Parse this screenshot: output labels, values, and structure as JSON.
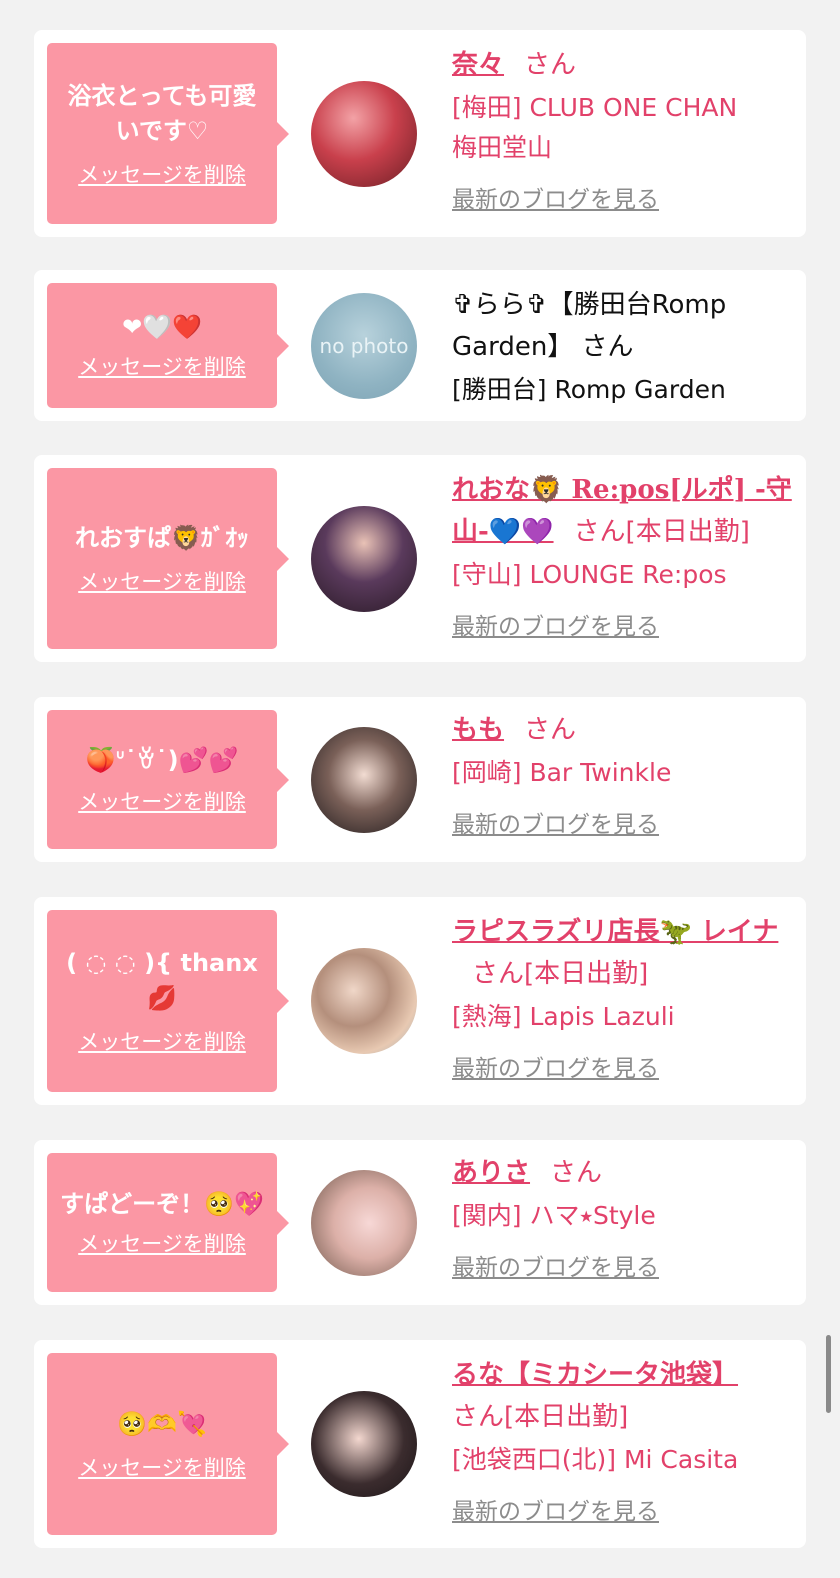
{
  "cards": [
    {
      "message": "浴衣とっても可愛いです♡",
      "delete_label": "メッセージを削除",
      "name": "奈々",
      "san": "さん",
      "shop_line1": "[梅田] CLUB ONE CHAN",
      "shop_line2": "梅田堂山",
      "blog_label": "最新のブログを見る"
    },
    {
      "message": "❤🤍❤️",
      "delete_label": "メッセージを削除",
      "name": "✞らら✞【勝田台Romp Garden】 さん",
      "shop_line1": "[勝田台] Romp Garden",
      "avatar_text": "no photo"
    },
    {
      "message": "れおすぱ🦁ｶﾞｵｯ",
      "delete_label": "メッセージを削除",
      "name": "れおな🦁 Re:pos[ルポ] -守山-💙💜",
      "san": "さん[本日出勤]",
      "shop_line1": "[守山] LOUNGE Re:pos",
      "blog_label": "最新のブログを見る"
    },
    {
      "message": "🍑ᐡ˙ꈊ˙)💕💕",
      "delete_label": "メッセージを削除",
      "name": "もも",
      "san": "さん",
      "shop_line1": "[岡崎] Bar Twinkle",
      "blog_label": "最新のブログを見る"
    },
    {
      "message": "( ◌ ◌ ){ thanx💋",
      "delete_label": "メッセージを削除",
      "name": "ラピスラズリ店長🦖 レイナ",
      "san": "さん[本日出勤]",
      "shop_line1": "[熱海] Lapis Lazuli",
      "blog_label": "最新のブログを見る"
    },
    {
      "message": "すぱどーぞ！🥺💖",
      "delete_label": "メッセージを削除",
      "name": "ありさ",
      "san": "さん",
      "shop_line1": "[関内] ハマ⭑Style",
      "blog_label": "最新のブログを見る"
    },
    {
      "message": "🥺🫶💘",
      "delete_label": "メッセージを削除",
      "name": "るな【ミカシータ池袋】",
      "san": "さん[本日出勤]",
      "shop_line1": "[池袋西口(北)] Mi Casita",
      "blog_label": "最新のブログを見る"
    }
  ]
}
